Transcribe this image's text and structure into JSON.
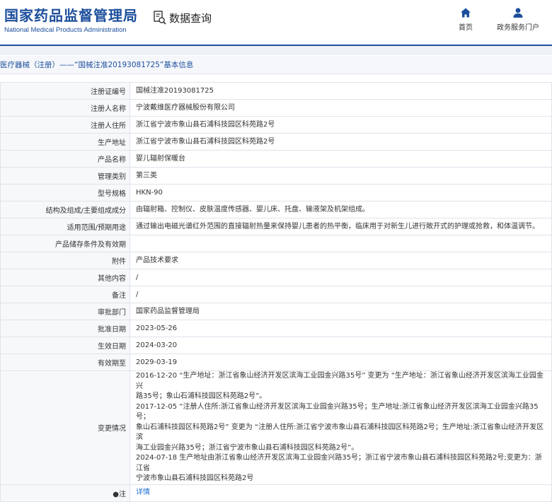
{
  "header": {
    "logo_cn": "国家药品监督管理局",
    "logo_en": "National Medical Products Administration",
    "query_label": "数据查询",
    "nav": [
      {
        "label": "首页",
        "icon": "home-icon"
      },
      {
        "label": "政务服务门户",
        "icon": "user-icon"
      }
    ]
  },
  "breadcrumb": "医疗器械（注册）——“国械注准20193081725”基本信息",
  "colors": {
    "brand": "#1c4e9c",
    "link": "#1c6fd1",
    "label_bg": "#f7f8fa",
    "border": "#dfe3ea"
  },
  "rows": [
    {
      "label": "注册证编号",
      "value": "国械注准20193081725"
    },
    {
      "label": "注册人名称",
      "value": "宁波戴维医疗器械股份有限公司"
    },
    {
      "label": "注册人住所",
      "value": "浙江省宁波市象山县石浦科技园区科苑路2号"
    },
    {
      "label": "生产地址",
      "value": "浙江省宁波市象山县石浦科技园区科苑路2号"
    },
    {
      "label": "产品名称",
      "value": "婴儿辐射保暖台"
    },
    {
      "label": "管理类别",
      "value": "第三类"
    },
    {
      "label": "型号规格",
      "value": "HKN-90"
    },
    {
      "label": "结构及组成/主要组成成分",
      "value": "由辐射箱、控制仪、皮肤温度传感器、婴儿床、托盘、输液架及机架组成。"
    },
    {
      "label": "适用范围/预期用途",
      "value": "通过输出电磁光谱红外范围的直接辐射热量来保持婴儿患者的热平衡，临床用于对新生儿进行敞开式的护理或抢救，和体温调节。"
    },
    {
      "label": "产品储存条件及有效期",
      "value": ""
    },
    {
      "label": "附件",
      "value": "产品技术要求"
    },
    {
      "label": "其他内容",
      "value": "/"
    },
    {
      "label": "备注",
      "value": "/"
    },
    {
      "label": "审批部门",
      "value": "国家药品监督管理局"
    },
    {
      "label": "批准日期",
      "value": "2023-05-26"
    },
    {
      "label": "生效日期",
      "value": "2024-03-20"
    },
    {
      "label": "有效期至",
      "value": "2029-03-19"
    }
  ],
  "changes": {
    "label": "变更情况",
    "lines": [
      "2016-12-20 “生产地址：浙江省象山经济开发区滨海工业园金兴路35号” 变更为 “生产地址：浙江省象山经济开发区滨海工业园金兴",
      "路35号；象山石浦科技园区科苑路2号”。",
      "2017-12-05 “注册人住所:浙江省象山经济开发区滨海工业园金兴路35号；生产地址:浙江省象山经济开发区滨海工业园金兴路35号；",
      "象山石浦科技园区科苑路2号” 变更为 “注册人住所:浙江省宁波市象山县石浦科技园区科苑路2号；生产地址:浙江省象山经济开发区滨",
      "海工业园金兴路35号；浙江省宁波市象山县石浦科技园区科苑路2号”。",
      "2024-07-18 生产地址由浙江省象山经济开发区滨海工业园金兴路35号；浙江省宁波市象山县石浦科技园区科苑路2号;变更为：浙江省",
      "宁波市象山县石浦科技园区科苑路2号"
    ]
  },
  "note": {
    "label": "注",
    "link": "详情"
  }
}
